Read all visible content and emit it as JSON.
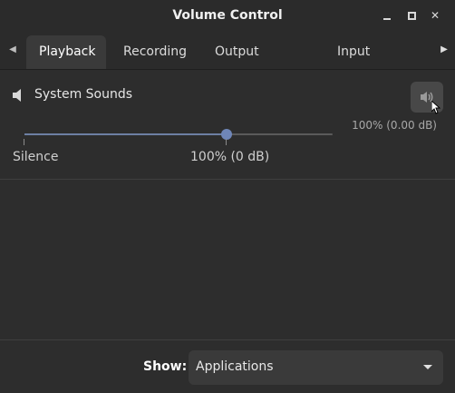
{
  "window": {
    "title": "Volume Control"
  },
  "tabs": [
    {
      "label": "Playback",
      "active": true
    },
    {
      "label": "Recording",
      "active": false
    },
    {
      "label": "Output Devices",
      "active": false
    },
    {
      "label": "Input Devices",
      "active": false
    }
  ],
  "stream": {
    "name": "System Sounds",
    "level_text": "100% (0.00 dB)",
    "volume_fraction": 0.655,
    "mute_icon": "speaker-volume-icon",
    "stream_icon": "speaker-icon"
  },
  "slider": {
    "mark_silence": "Silence",
    "mark_100": "100% (0 dB)"
  },
  "footer": {
    "show_label": "Show:",
    "show_value": "Applications"
  },
  "colors": {
    "accent": "#6f86b8",
    "background": "#2d2d2d"
  }
}
